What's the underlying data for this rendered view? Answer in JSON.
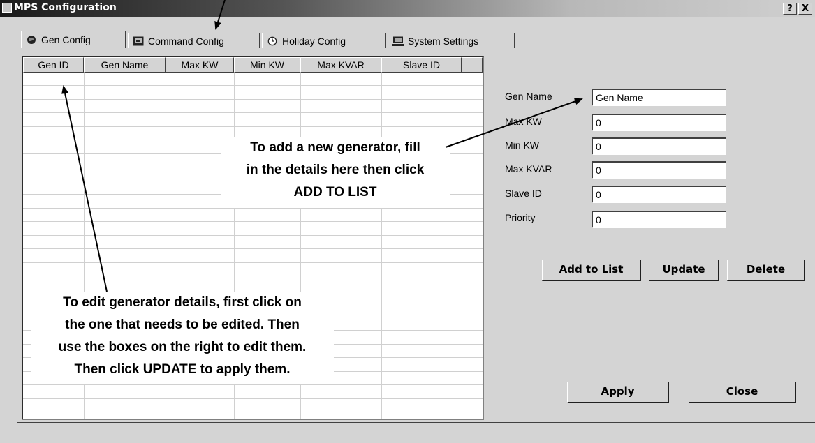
{
  "window": {
    "title": "MPS Configuration",
    "help_label": "?",
    "close_label": "X"
  },
  "tabs": [
    {
      "label": "Gen Config",
      "icon": "globe-icon",
      "active": true
    },
    {
      "label": "Command Config",
      "icon": "terminal-icon",
      "active": false
    },
    {
      "label": "Holiday Config",
      "icon": "clock-icon",
      "active": false
    },
    {
      "label": "System Settings",
      "icon": "computer-icon",
      "active": false
    }
  ],
  "table": {
    "columns": [
      "Gen ID",
      "Gen Name",
      "Max KW",
      "Min KW",
      "Max KVAR",
      "Slave ID"
    ],
    "rows": []
  },
  "form": {
    "gen_name": {
      "label": "Gen Name",
      "value": "Gen Name"
    },
    "max_kw": {
      "label": "Max KW",
      "value": "0"
    },
    "min_kw": {
      "label": "Min KW",
      "value": "0"
    },
    "max_kvar": {
      "label": "Max KVAR",
      "value": "0"
    },
    "slave_id": {
      "label": "Slave ID",
      "value": "0"
    },
    "priority": {
      "label": "Priority",
      "value": "0"
    }
  },
  "buttons": {
    "add_to_list": "Add to List",
    "update": "Update",
    "delete": "Delete",
    "apply": "Apply",
    "close": "Close"
  },
  "annotations": {
    "add_line1": "To add a new generator, fill",
    "add_line2": "in the details here then click",
    "add_line3": "ADD TO LIST",
    "edit_line1": "To edit generator details, first click on",
    "edit_line2": "the one that needs to be edited. Then",
    "edit_line3": "use the boxes on the right to edit them.",
    "edit_line4": "Then click UPDATE to apply them."
  }
}
